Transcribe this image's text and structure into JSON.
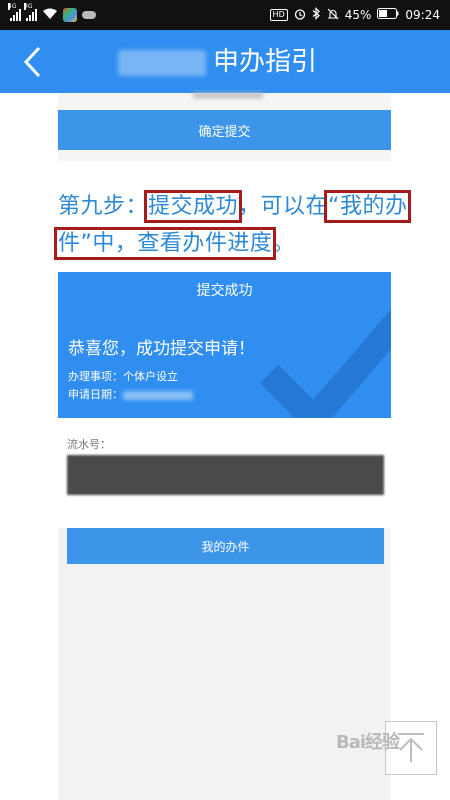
{
  "status_bar": {
    "network_1": "4G",
    "network_2": "3G",
    "badge_hd": "HD",
    "battery": "45%",
    "time": "09:24"
  },
  "app_bar": {
    "title": "申办指引"
  },
  "top_screenshot": {
    "confirm_button": "确定提交"
  },
  "step": {
    "p1": "第九步：",
    "h1": "提交成功",
    "p2": "，可以在",
    "h2a": "“我的办",
    "h2b": "件”中，查看办件进度",
    "p3": "。"
  },
  "result": {
    "title": "提交成功",
    "congrats": "恭喜您，成功提交申请！",
    "item_label": "办理事项：",
    "item_value": "个体户设立",
    "date_label": "申请日期：",
    "serial_label": "流水号：",
    "my_button": "我的办件"
  },
  "watermark": "Bai经验",
  "colors": {
    "primary": "#2f8ef0",
    "step_text": "#2c89d6",
    "highlight": "#a61c1c"
  }
}
